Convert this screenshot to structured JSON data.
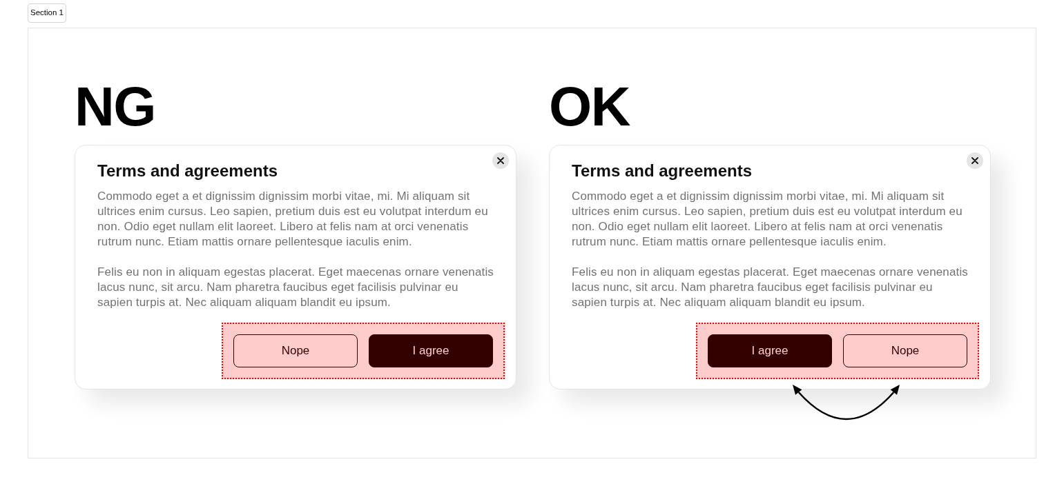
{
  "section_tab": "Section 1",
  "panels": [
    {
      "heading": "NG",
      "dialog": {
        "title": "Terms and agreements",
        "paragraphs": [
          "Commodo eget a et dignissim dignissim morbi vitae, mi. Mi aliquam sit ultrices enim cursus. Leo sapien, pretium duis est eu volutpat interdum eu non. Odio eget nullam elit laoreet. Libero at felis nam at orci venenatis rutrum nunc. Etiam mattis ornare pellentesque iaculis enim.",
          "Felis eu non in aliquam egestas placerat. Eget maecenas ornare venenatis lacus nunc, sit arcu. Nam pharetra faucibus eget facilisis pulvinar eu sapien turpis at. Nec aliquam aliquam blandit eu ipsum."
        ],
        "buttons": [
          {
            "label": "Nope",
            "kind": "outline"
          },
          {
            "label": "I agree",
            "kind": "filled"
          }
        ]
      },
      "swap_arrow": false
    },
    {
      "heading": "OK",
      "dialog": {
        "title": "Terms and agreements",
        "paragraphs": [
          "Commodo eget a et dignissim dignissim morbi vitae, mi. Mi aliquam sit ultrices enim cursus. Leo sapien, pretium duis est eu volutpat interdum eu non. Odio eget nullam elit laoreet. Libero at felis nam at orci venenatis rutrum nunc. Etiam mattis ornare pellentesque iaculis enim.",
          "Felis eu non in aliquam egestas placerat. Eget maecenas ornare venenatis lacus nunc, sit arcu. Nam pharetra faucibus eget facilisis pulvinar eu sapien turpis at. Nec aliquam aliquam blandit eu ipsum."
        ],
        "buttons": [
          {
            "label": "I agree",
            "kind": "filled"
          },
          {
            "label": "Nope",
            "kind": "outline"
          }
        ]
      },
      "swap_arrow": true
    }
  ]
}
